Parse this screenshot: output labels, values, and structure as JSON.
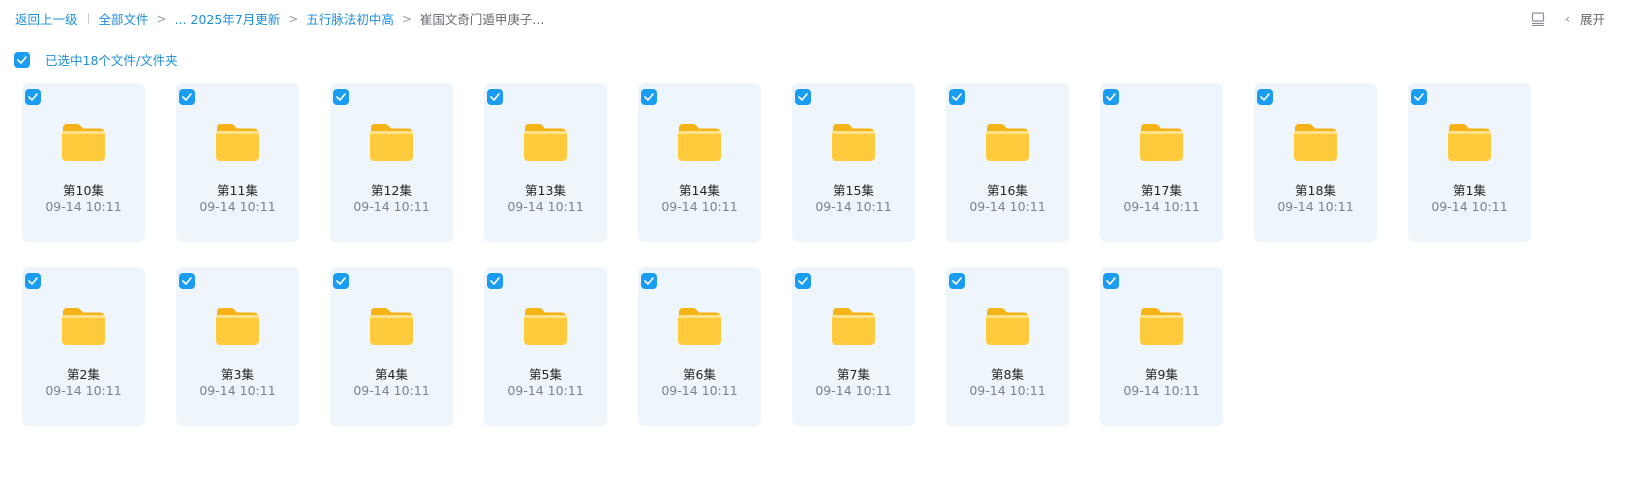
{
  "breadcrumb": {
    "back": "返回上一级",
    "root": "全部文件",
    "sep": ">",
    "level1": "... 2025年7月更新",
    "level2": "五行脉法初中高",
    "current": "崔国文奇门遁甲庚子..."
  },
  "toolbar": {
    "expand_label": "展开",
    "layout_icon": "layout-icon",
    "chevron": "‹"
  },
  "selection": {
    "label": "已选中18个文件/文件夹",
    "checked": true
  },
  "colors": {
    "accent": "#1a9cf0",
    "card_bg": "#eef6fc",
    "folder": "#ffc93c"
  },
  "files": [
    {
      "name": "第10集",
      "time": "09-14 10:11"
    },
    {
      "name": "第11集",
      "time": "09-14 10:11"
    },
    {
      "name": "第12集",
      "time": "09-14 10:11"
    },
    {
      "name": "第13集",
      "time": "09-14 10:11"
    },
    {
      "name": "第14集",
      "time": "09-14 10:11"
    },
    {
      "name": "第15集",
      "time": "09-14 10:11"
    },
    {
      "name": "第16集",
      "time": "09-14 10:11"
    },
    {
      "name": "第17集",
      "time": "09-14 10:11"
    },
    {
      "name": "第18集",
      "time": "09-14 10:11"
    },
    {
      "name": "第1集",
      "time": "09-14 10:11"
    },
    {
      "name": "第2集",
      "time": "09-14 10:11"
    },
    {
      "name": "第3集",
      "time": "09-14 10:11"
    },
    {
      "name": "第4集",
      "time": "09-14 10:11"
    },
    {
      "name": "第5集",
      "time": "09-14 10:11"
    },
    {
      "name": "第6集",
      "time": "09-14 10:11"
    },
    {
      "name": "第7集",
      "time": "09-14 10:11"
    },
    {
      "name": "第8集",
      "time": "09-14 10:11"
    },
    {
      "name": "第9集",
      "time": "09-14 10:11"
    }
  ]
}
